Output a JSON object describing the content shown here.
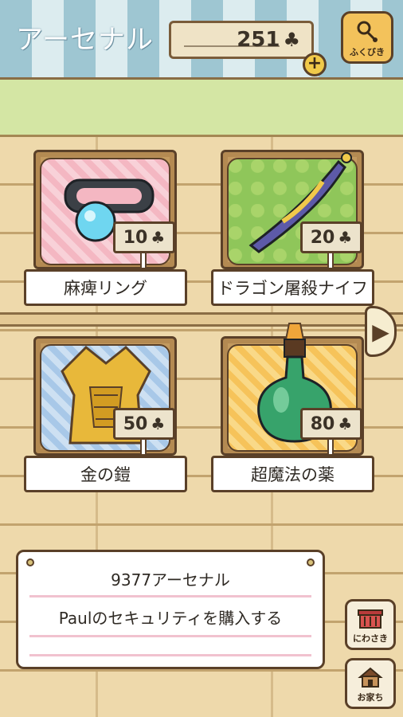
{
  "header": {
    "title": "アーセナル",
    "coins": "251",
    "currency_icon": "clover-icon",
    "gacha_label": "ふくびき"
  },
  "items": [
    {
      "name": "麻痺リング",
      "price": "10",
      "cloth": "pink"
    },
    {
      "name": "ドラゴン屠殺ナイフ",
      "price": "20",
      "cloth": "green"
    },
    {
      "name": "金の鎧",
      "price": "50",
      "cloth": "blue"
    },
    {
      "name": "超魔法の薬",
      "price": "80",
      "cloth": "yellow"
    }
  ],
  "dialog": {
    "line1": "9377アーセナル",
    "line2": "Paulのセキュリティを購入する"
  },
  "nav": {
    "yard_label": "にわさき",
    "home_label": "お家ち"
  },
  "symbols": {
    "club": "♣",
    "plus": "+",
    "arrow": "▶"
  },
  "colors": {
    "awning_blue": "#9ec6d2",
    "grass": "#d4e6a4",
    "wood": "#eed9ab",
    "outline": "#5a4028",
    "coin_button": "#f0c94a"
  }
}
